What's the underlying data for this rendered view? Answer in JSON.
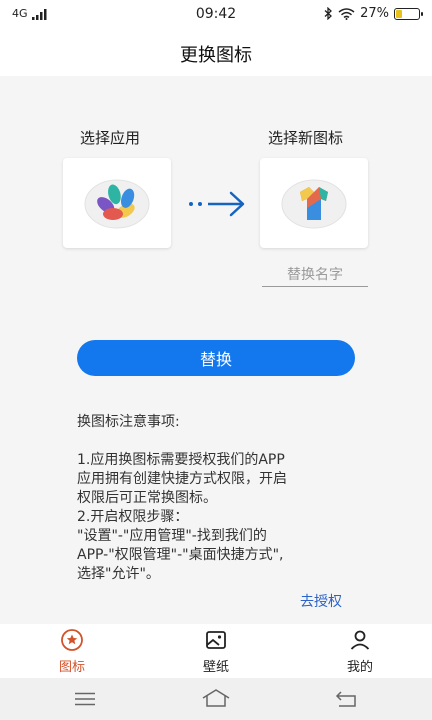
{
  "status_bar": {
    "network": "4G",
    "time": "09:42",
    "battery": "27%",
    "battery_level": 0.27
  },
  "nav": {
    "title": "更换图标"
  },
  "selector": {
    "choose_app_label": "选择应用",
    "choose_icon_label": "选择新图标"
  },
  "rename": {
    "placeholder": "替换名字",
    "value": ""
  },
  "replace_button": {
    "label": "替换"
  },
  "notes": {
    "title": "换图标注意事项:",
    "lines": [
      "1.应用换图标需要授权我们的APP",
      "应用拥有创建快捷方式权限，开启",
      "权限后可正常换图标。",
      "2.开启权限步骤：",
      "\"设置\"-\"应用管理\"-找到我们的",
      "APP-\"权限管理\"-\"桌面快捷方式\",",
      "选择\"允许\"。"
    ]
  },
  "authorize_link": {
    "label": "去授权"
  },
  "tabs": [
    {
      "label": "图标",
      "icon": "star-circle-icon",
      "active": true
    },
    {
      "label": "壁纸",
      "icon": "image-icon",
      "active": false
    },
    {
      "label": "我的",
      "icon": "person-icon",
      "active": false
    }
  ],
  "colors": {
    "primary": "#1377ee",
    "active_tab": "#d2532b",
    "link": "#2b63c8",
    "background": "#f5f5f5"
  }
}
